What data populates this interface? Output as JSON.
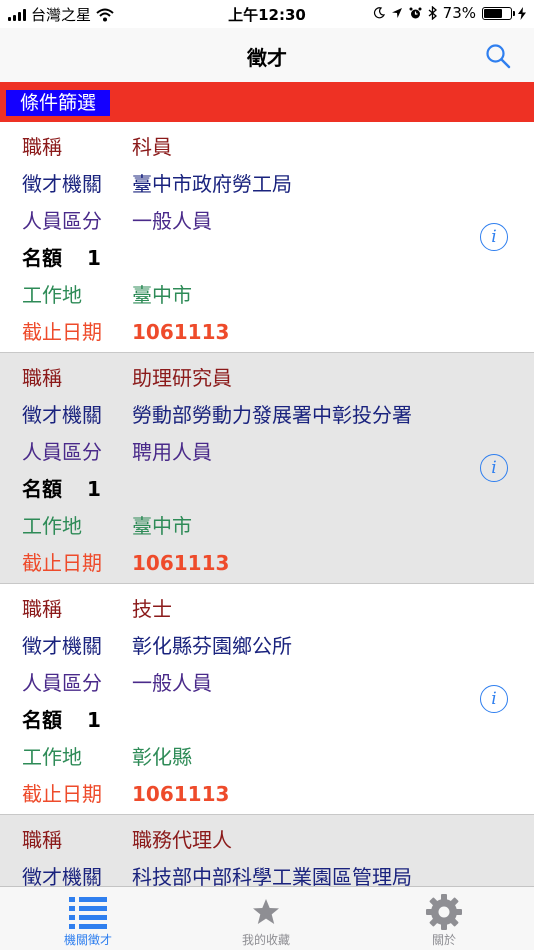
{
  "status_bar": {
    "carrier": "台灣之星",
    "time": "上午12:30",
    "battery_percent": "73%",
    "battery_level": 0.73
  },
  "nav": {
    "title": "徵才"
  },
  "filter": {
    "label": "條件篩選"
  },
  "labels": {
    "job_title": "職稱",
    "agency": "徵才機關",
    "category": "人員區分",
    "quota": "名額",
    "location": "工作地",
    "deadline": "截止日期"
  },
  "jobs": [
    {
      "job_title": "科員",
      "agency": "臺中市政府勞工局",
      "category": "一般人員",
      "quota": "1",
      "location": "臺中市",
      "deadline": "1061113"
    },
    {
      "job_title": "助理研究員",
      "agency": "勞動部勞動力發展署中彰投分署",
      "category": "聘用人員",
      "quota": "1",
      "location": "臺中市",
      "deadline": "1061113"
    },
    {
      "job_title": "技士",
      "agency": "彰化縣芬園鄉公所",
      "category": "一般人員",
      "quota": "1",
      "location": "彰化縣",
      "deadline": "1061113"
    },
    {
      "job_title": "職務代理人",
      "agency": "科技部中部科學工業園區管理局"
    }
  ],
  "tabs": [
    {
      "label": "機關徵才",
      "icon": "list-icon",
      "active": true
    },
    {
      "label": "我的收藏",
      "icon": "star-icon",
      "active": false
    },
    {
      "label": "關於",
      "icon": "gear-icon",
      "active": false
    }
  ],
  "colors": {
    "filter_bar": "#ee3124",
    "filter_button": "#1400ff",
    "accent": "#2f7fef"
  }
}
